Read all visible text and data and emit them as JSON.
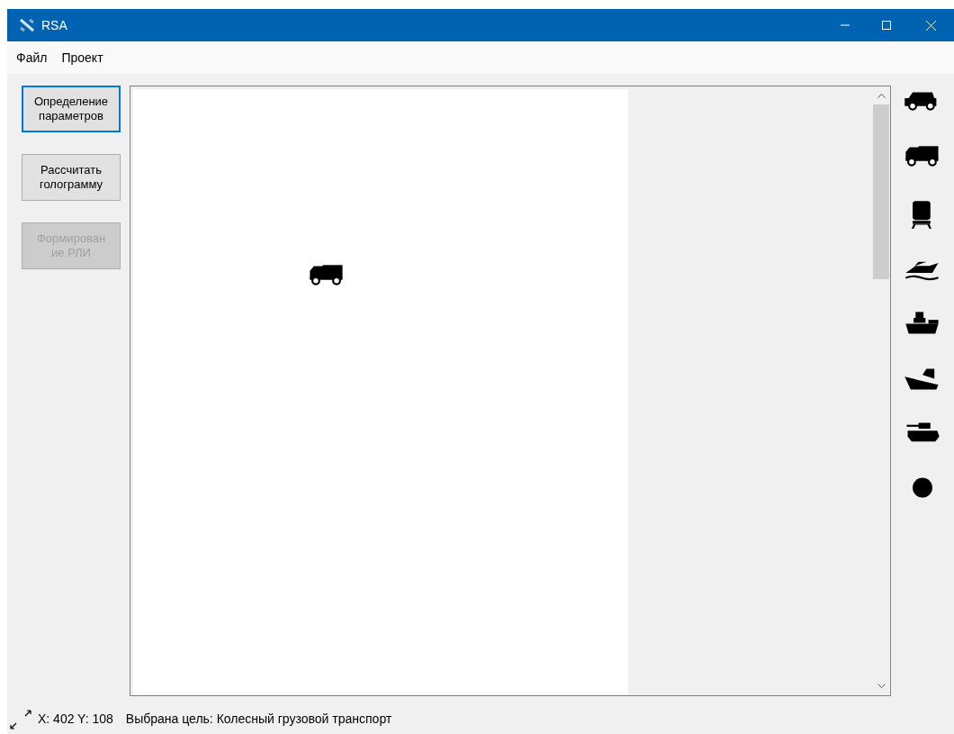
{
  "window": {
    "title": "RSA"
  },
  "menu": [
    "Файл",
    "Проект"
  ],
  "buttons": [
    {
      "label": "Определение параметров",
      "focused": true,
      "disabled": false
    },
    {
      "label": "Рассчитать голограмму",
      "focused": false,
      "disabled": false
    },
    {
      "label": "Формирован ие РЛИ",
      "focused": false,
      "disabled": true
    }
  ],
  "canvas": {
    "targets": [
      {
        "kind": "truck"
      }
    ]
  },
  "palette": [
    {
      "kind": "jeep"
    },
    {
      "kind": "truck"
    },
    {
      "kind": "train"
    },
    {
      "kind": "boat"
    },
    {
      "kind": "cargo-ship"
    },
    {
      "kind": "ship"
    },
    {
      "kind": "tank"
    },
    {
      "kind": "point"
    }
  ],
  "status_bar": {
    "coords": "X: 402 Y: 108",
    "message": "Выбрана цель: Колесный грузовой транспорт"
  }
}
